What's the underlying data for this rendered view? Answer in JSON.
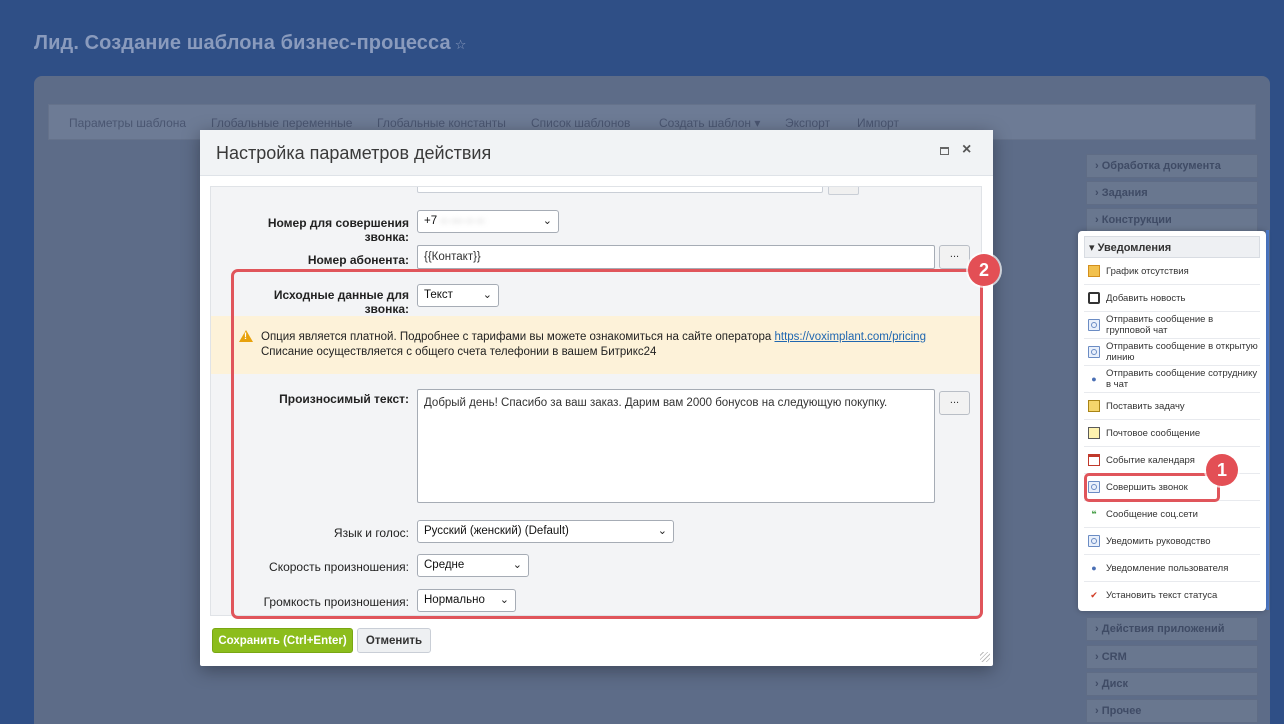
{
  "page": {
    "title": "Лид. Создание шаблона бизнес-процесса",
    "star_icon": "☆"
  },
  "top_tabs": [
    "Параметры шаблона",
    "Глобальные переменные",
    "Глобальные константы",
    "Список шаблонов",
    "Создать шаблон ▾",
    "Экспорт",
    "Импорт"
  ],
  "right_panel": {
    "categories_top": [
      "Обработка документа",
      "Задания",
      "Конструкции"
    ],
    "categories_bottom": [
      "Действия приложений",
      "CRM",
      "Диск",
      "Прочее"
    ],
    "notifications": {
      "header": "▾ Уведомления",
      "items": [
        {
          "label": "График отсутствия",
          "icon": "calendar-schedule-icon"
        },
        {
          "label": "Добавить новость",
          "icon": "news-icon"
        },
        {
          "label": "Отправить сообщение в групповой чат",
          "icon": "chat-icon"
        },
        {
          "label": "Отправить сообщение в открытую линию",
          "icon": "chat-icon"
        },
        {
          "label": "Отправить сообщение сотруднику в чат",
          "icon": "user-icon"
        },
        {
          "label": "Поставить задачу",
          "icon": "task-icon"
        },
        {
          "label": "Почтовое сообщение",
          "icon": "mail-icon"
        },
        {
          "label": "Событие календаря",
          "icon": "calendar-event-icon"
        },
        {
          "label": "Совершить звонок",
          "icon": "call-icon"
        },
        {
          "label": "Сообщение соц.сети",
          "icon": "social-message-icon"
        },
        {
          "label": "Уведомить руководство",
          "icon": "chat-icon"
        },
        {
          "label": "Уведомление пользователя",
          "icon": "user-icon"
        },
        {
          "label": "Установить текст статуса",
          "icon": "checkmark-icon"
        }
      ]
    }
  },
  "badges": {
    "first": "1",
    "second": "2"
  },
  "modal": {
    "title": "Настройка параметров действия",
    "maximize_icon": "□",
    "close_icon": "×",
    "fields": {
      "call_number_label": "Номер для совершения звонка:",
      "call_number_value_prefix": "+7",
      "call_number_value_hidden": "-- --- -- --",
      "subscriber_label": "Номер абонента:",
      "subscriber_value": "{{Контакт}}",
      "source_label": "Исходные данные для звонка:",
      "source_value": "Текст",
      "warning_line1": "Опция является платной. Подробнее с тарифами вы можете ознакомиться на сайте оператора",
      "warning_link": "https://voximplant.com/pricing",
      "warning_line2": "Списание осуществляется с общего счета телефонии в вашем Битрикс24",
      "spoken_text_label": "Произносимый текст:",
      "spoken_text_value": "Добрый день! Спасибо за ваш заказ. Дарим вам 2000 бонусов на следующую покупку.",
      "language_label": "Язык и голос:",
      "language_value": "Русский (женский) (Default)",
      "speed_label": "Скорость произношения:",
      "speed_value": "Средне",
      "volume_label": "Громкость произношения:",
      "volume_value": "Нормально",
      "dots_label": "..."
    },
    "buttons": {
      "save": "Сохранить (Ctrl+Enter)",
      "cancel": "Отменить"
    }
  },
  "colors": {
    "overlay": "#2f4f86",
    "highlight": "#e0555b",
    "save_button": "#8cbd1c",
    "warning_bg": "#fdf2d9",
    "link": "#2067b0"
  }
}
